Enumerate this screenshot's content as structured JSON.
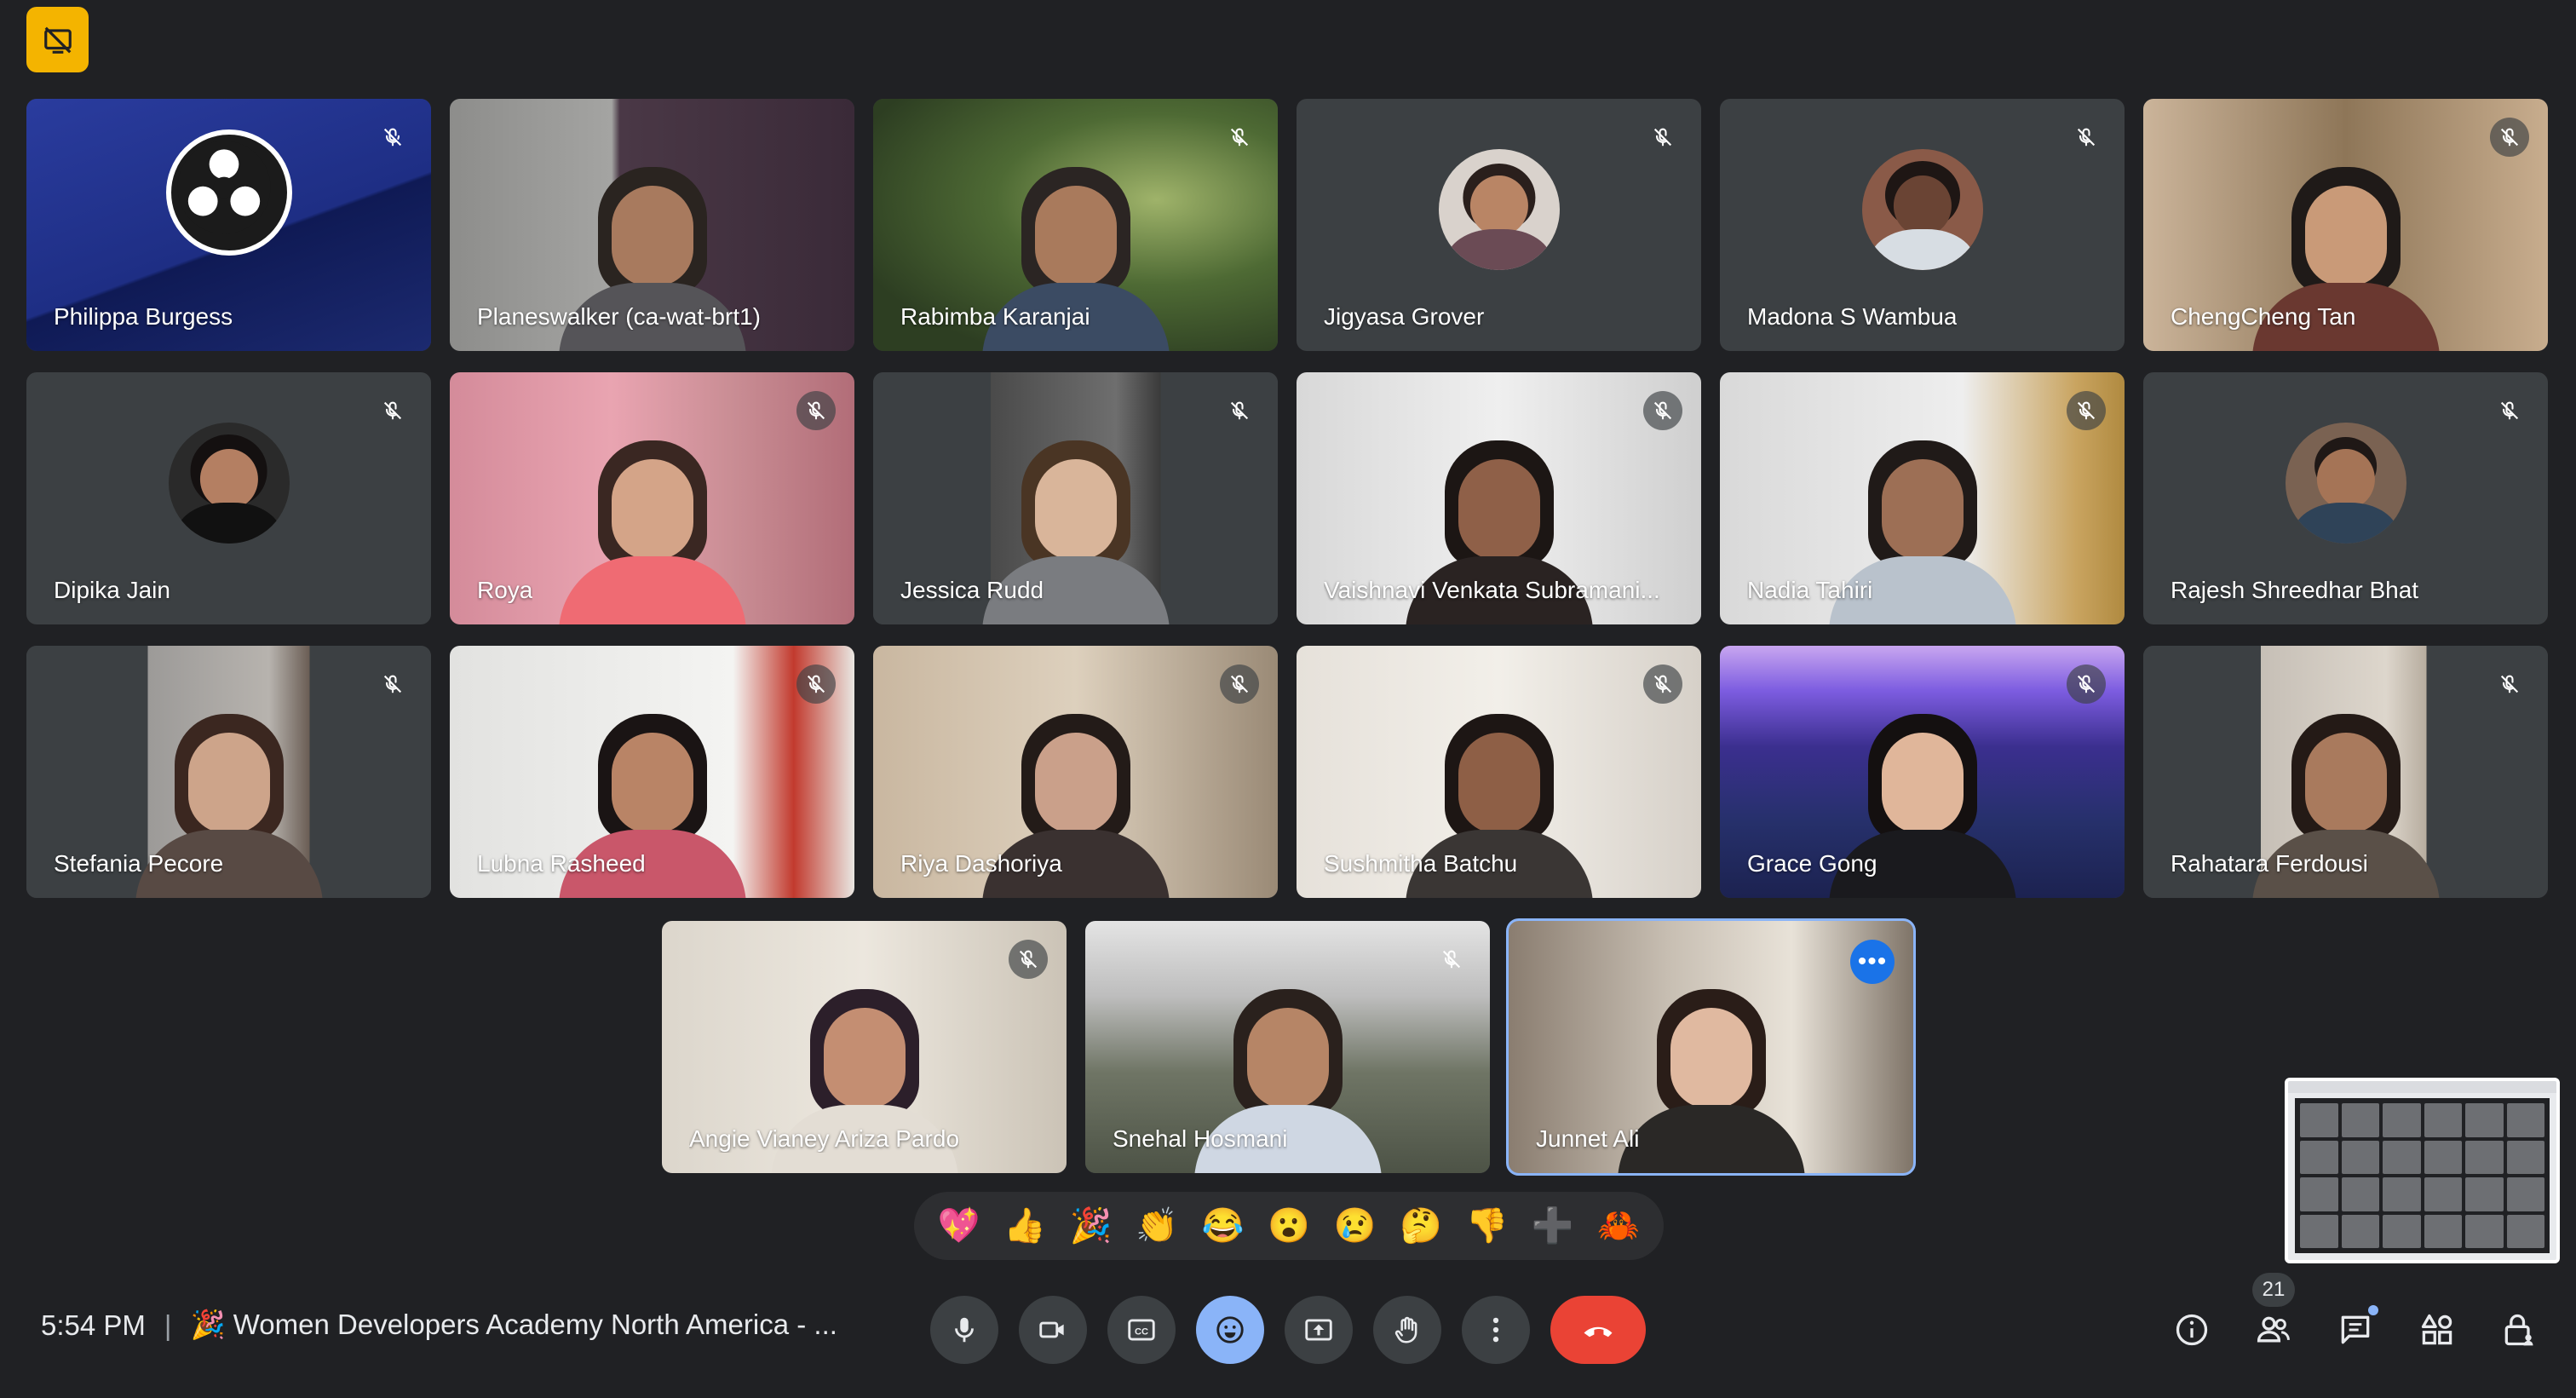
{
  "meeting": {
    "time": "5:54 PM",
    "separator": "|",
    "title": "🎉 Women Developers Academy North America - ...",
    "participant_count": "21"
  },
  "participants_grid": [
    {
      "name": "Philippa Burgess",
      "muted": true
    },
    {
      "name": "Planeswalker (ca-wat-brt1)",
      "muted": false
    },
    {
      "name": "Rabimba Karanjai",
      "muted": true
    },
    {
      "name": "Jigyasa Grover",
      "muted": true
    },
    {
      "name": "Madona S Wambua",
      "muted": true
    },
    {
      "name": "ChengCheng Tan",
      "muted": true
    },
    {
      "name": "Dipika Jain",
      "muted": true
    },
    {
      "name": "Roya",
      "muted": true
    },
    {
      "name": "Jessica Rudd",
      "muted": true
    },
    {
      "name": "Vaishnavi Venkata Subramani...",
      "muted": true
    },
    {
      "name": "Nadia Tahiri",
      "muted": true
    },
    {
      "name": "Rajesh Shreedhar Bhat",
      "muted": true
    },
    {
      "name": "Stefania Pecore",
      "muted": true
    },
    {
      "name": "Lubna Rasheed",
      "muted": true
    },
    {
      "name": "Riya Dashoriya",
      "muted": true
    },
    {
      "name": "Sushmitha Batchu",
      "muted": true
    },
    {
      "name": "Grace Gong",
      "muted": true
    },
    {
      "name": "Rahatara Ferdousi",
      "muted": true
    }
  ],
  "participants_bottom": [
    {
      "name": "Angie Vianey Ariza Pardo",
      "muted": true
    },
    {
      "name": "Snehal Hosmani",
      "muted": true
    },
    {
      "name": "Junnet Ali",
      "muted": false,
      "active": true
    }
  ],
  "reactions": [
    "💖",
    "👍",
    "🎉",
    "👏",
    "😂",
    "😮",
    "😢",
    "🤔",
    "👎",
    "➕",
    "🦀"
  ],
  "controls": {
    "more_label": "•••"
  },
  "colors": {
    "background": "#202124",
    "tile": "#3c4043",
    "accent": "#8ab4f8",
    "hangup": "#ea4335",
    "badge_yellow": "#f4b400"
  },
  "icons": {
    "top_badge": "no-presenting-icon",
    "mic": "mic-icon",
    "camera": "camera-icon",
    "captions": "captions-icon",
    "reactions": "emoji-icon",
    "present": "present-screen-icon",
    "raise_hand": "raise-hand-icon",
    "more": "more-vert-icon",
    "hangup": "call-end-icon",
    "info": "info-icon",
    "people": "people-icon",
    "chat": "chat-icon",
    "activities": "activities-icon",
    "host_controls": "lock-person-icon"
  }
}
